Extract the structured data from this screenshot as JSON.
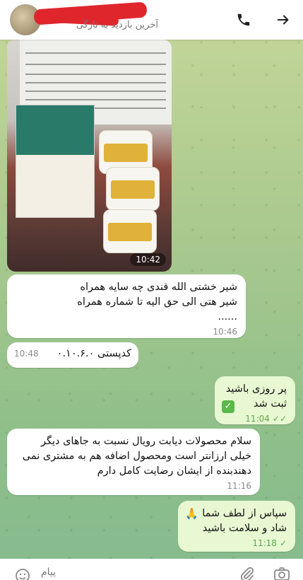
{
  "header": {
    "status": "آخرین بازدید به تازگی"
  },
  "messages": [
    {
      "type": "photo",
      "time": "10:42"
    },
    {
      "type": "text",
      "text": "شیر خشتی الله قندی چه سایه همراه\nشیر هتی الی حق الیه تا شماره همراه\n......",
      "time": "10:46"
    },
    {
      "type": "text",
      "text": "کدپستی ۰.۱۰.۶.۰",
      "time": "10:48"
    },
    {
      "type": "text-out",
      "text": "پر روزی باشید\nثبت شد",
      "time": "11:04"
    },
    {
      "type": "text",
      "text": "سلام محصولات دیابت رویال نسبت به جاهای دیگر\nخیلی ارزانتر است ومحصول اضافه هم به مشتری نمی\nدهندبنده از ایشان رضایت کامل دارم",
      "time": "11:16"
    },
    {
      "type": "text-out",
      "text": "سپاس از لطف شما\nشاد و سلامت باشید",
      "time": "11:18"
    }
  ],
  "input": {
    "placeholder": "پیام"
  },
  "icons": [
    "back-arrow-icon",
    "call-icon",
    "emoji-icon",
    "attach-icon",
    "camera-icon"
  ],
  "colors": {
    "outgoing_bubble": "#e8f8d2",
    "tick_color": "#5ea64e"
  }
}
